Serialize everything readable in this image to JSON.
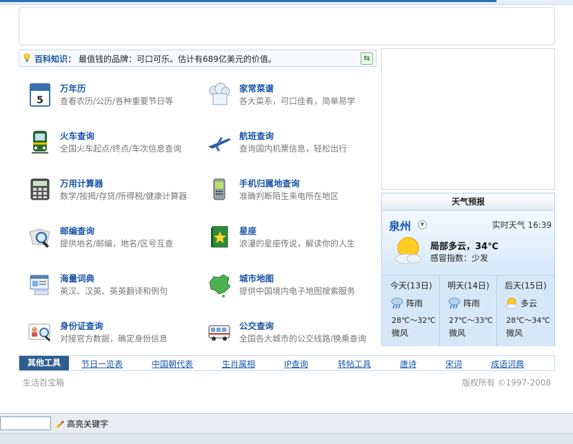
{
  "tip": {
    "label": "百科知识：",
    "text": "最值钱的品牌：可口可乐。估计有689亿美元的价值。"
  },
  "tools": [
    {
      "title": "万年历",
      "desc": "查看农历/公历/各种重要节日等",
      "icon": "calendar-icon",
      "icon_text": "5"
    },
    {
      "title": "家常菜谱",
      "desc": "各大菜系，可口佳肴，简单易学",
      "icon": "chef-hat-icon"
    },
    {
      "title": "火车查询",
      "desc": "全国火车起点/终点/车次信息查询",
      "icon": "train-icon"
    },
    {
      "title": "航班查询",
      "desc": "查询国内机票信息，轻松出行",
      "icon": "airplane-icon"
    },
    {
      "title": "万用计算器",
      "desc": "数学/按揭/存贷/所得税/健康计算器",
      "icon": "calculator-icon"
    },
    {
      "title": "手机归属地查询",
      "desc": "准确判断陌生来电所在地区",
      "icon": "mobile-phone-icon"
    },
    {
      "title": "邮编查询",
      "desc": "提供地名/邮编，地名/区号互查",
      "icon": "magnifier-map-icon"
    },
    {
      "title": "星座",
      "desc": "浪漫的星座传说，解读你的人生",
      "icon": "star-book-icon"
    },
    {
      "title": "海量词典",
      "desc": "英汉、汉英、英英翻译和例句",
      "icon": "dictionary-icon"
    },
    {
      "title": "城市地图",
      "desc": "提供中国境内电子地图搜索服务",
      "icon": "china-map-icon"
    },
    {
      "title": "身份证查询",
      "desc": "对接官方数据，确定身份信息",
      "icon": "id-card-icon"
    },
    {
      "title": "公交查询",
      "desc": "全国各大城市的公交线路/换乘查询",
      "icon": "bus-icon"
    }
  ],
  "weather": {
    "header": "天气预报",
    "city": "泉州",
    "realtime": "实时天气 16:39",
    "now_desc": "局部多云，34℃",
    "cold_index": "感冒指数：少发",
    "days": [
      {
        "name": "今天(13日)",
        "cond": "阵雨",
        "temp": "28℃～32℃",
        "wind": "微风",
        "icon": "rain-shower-icon"
      },
      {
        "name": "明天(14日)",
        "cond": "阵雨",
        "temp": "27℃～33℃",
        "wind": "微风",
        "icon": "rain-shower-icon"
      },
      {
        "name": "后天(15日)",
        "cond": "多云",
        "temp": "28℃～34℃",
        "wind": "微风",
        "icon": "cloudy-sun-icon"
      }
    ]
  },
  "other_tools": {
    "label": "其他工具",
    "links": [
      "节日一览表",
      "中国朝代表",
      "生肖属相",
      "IP查询",
      "转帖工具",
      "唐诗",
      "宋词",
      "成语词典"
    ]
  },
  "footer": {
    "left": "生活百宝箱",
    "right": "版权所有 ©1997-2008"
  },
  "findbar": {
    "highlight_label": "高亮关键字"
  }
}
